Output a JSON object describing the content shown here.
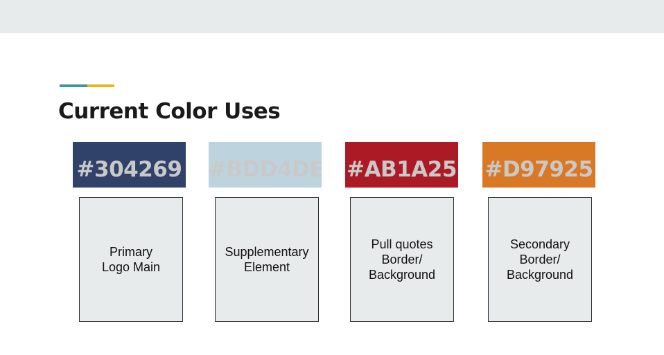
{
  "slide": {
    "title": "Current Color Uses",
    "accent_colors": [
      "#3d9697",
      "#e5b820"
    ]
  },
  "colors": [
    {
      "code": "#304269",
      "hex": "#304269",
      "use": "Primary\nLogo Main"
    },
    {
      "code": "#BDD4DE",
      "hex": "#BDD4DE",
      "use": "Supplementary\nElement"
    },
    {
      "code": "#AB1A25",
      "hex": "#AB1A25",
      "use": "Pull quotes\nBorder/\nBackground"
    },
    {
      "code": "#D97925",
      "hex": "#D97925",
      "use": "Secondary\nBorder/\nBackground"
    }
  ]
}
